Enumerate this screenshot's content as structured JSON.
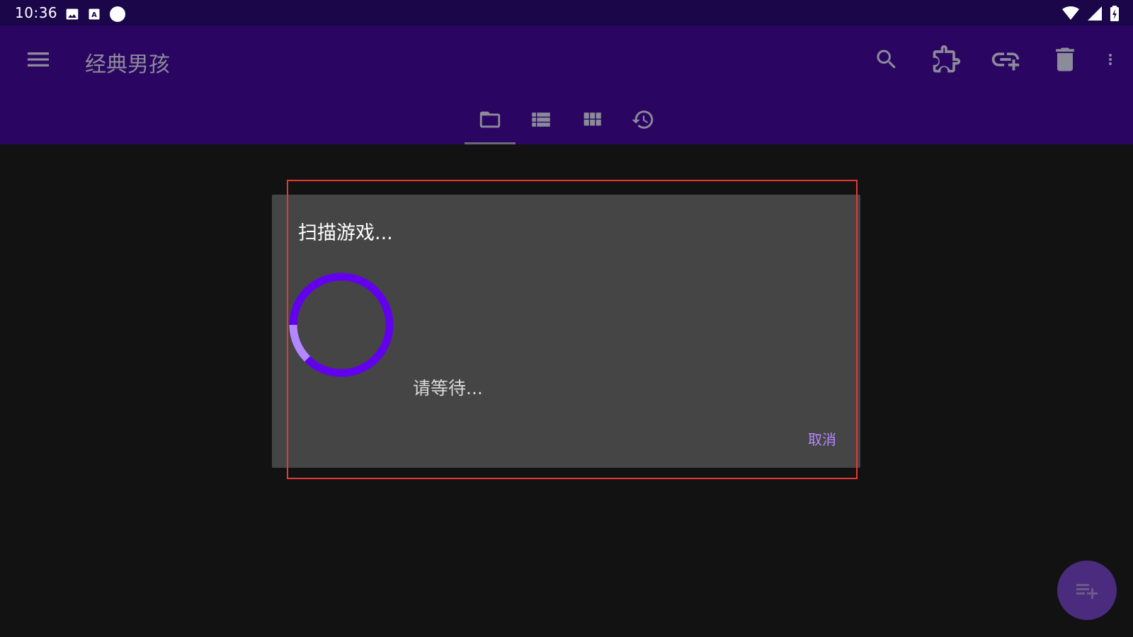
{
  "status_bar": {
    "time": "10:36",
    "left_icons": [
      "image-icon",
      "keyboard-a-icon",
      "circle-icon"
    ],
    "right_icons": [
      "wifi-icon",
      "signal-icon",
      "battery-icon"
    ]
  },
  "app_bar": {
    "title": "经典男孩",
    "actions": [
      "search-icon",
      "puzzle-icon",
      "add-link-icon",
      "trash-icon",
      "more-vert-icon"
    ],
    "tabs": [
      {
        "icon": "folder-icon",
        "active": true
      },
      {
        "icon": "list-icon",
        "active": false
      },
      {
        "icon": "grid-icon",
        "active": false
      },
      {
        "icon": "history-icon",
        "active": false
      }
    ]
  },
  "dialog": {
    "title": "扫描游戏...",
    "message": "请等待...",
    "cancel_label": "取消"
  },
  "fab": {
    "icon": "playlist-add-icon"
  },
  "colors": {
    "app_bar": "#2b0562",
    "status_bar": "#1a0649",
    "accent": "#b388ff",
    "spinner": "#6200ee",
    "background": "#121212",
    "dialog": "#454545"
  }
}
